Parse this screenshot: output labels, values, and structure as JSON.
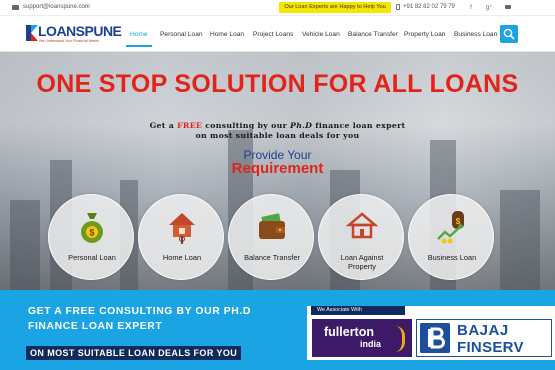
{
  "topbar": {
    "email": "support@loanspune.com",
    "help_text": "Our Loan Experts are Happy to Help You",
    "phone": "+91 82 82 02 79 79",
    "social_icons": [
      "facebook-icon",
      "google-plus-icon",
      "email-icon"
    ]
  },
  "logo": {
    "name_part1": "LOANS",
    "name_part2": "PUNE",
    "tagline": "We Understand Your Financial Needs"
  },
  "nav": {
    "items": [
      {
        "label": "Home",
        "active": true
      },
      {
        "label": "Personal Loan"
      },
      {
        "label": "Home Loan"
      },
      {
        "label": "Project Loans"
      },
      {
        "label": "Vehicle Loan"
      },
      {
        "label": "Balance Transfer"
      },
      {
        "label": "Property Loan"
      },
      {
        "label": "Business Loan"
      }
    ],
    "search_icon": "search-icon"
  },
  "hero": {
    "title": "ONE STOP SOLUTION FOR ALL LOANS",
    "sub_line1_a": "Get a ",
    "sub_line1_free": "FREE",
    "sub_line1_b": " consulting by our ",
    "sub_line1_phd": "Ph.D",
    "sub_line1_c": " finance loan expert",
    "sub_line2": "on most suitable loan deals for you",
    "provide_line1": "Provide Your",
    "provide_line2": "Requirement",
    "cards": [
      {
        "label": "Personal Loan",
        "icon": "money-bag-icon"
      },
      {
        "label": "Home Loan",
        "icon": "house-icon"
      },
      {
        "label": "Balance Transfer",
        "icon": "wallet-icon"
      },
      {
        "label": "Loan Against",
        "label2": "Property",
        "icon": "property-icon"
      },
      {
        "label": "Business Loan",
        "icon": "business-growth-icon"
      }
    ]
  },
  "band": {
    "line1": "GET A FREE CONSULTING BY OUR PH.D",
    "line2": "FINANCE LOAN EXPERT",
    "line3": "ON MOST SUITABLE LOAN DEALS FOR YOU",
    "assoc_header": "We Associate With",
    "partner1_a": "fullerton",
    "partner1_b": "india",
    "partner2_a": "BAJAJ",
    "partner2_b": "FINSERV"
  },
  "colors": {
    "brand_blue": "#1ba4e4",
    "navy": "#0e2b5c",
    "red": "#e2231a",
    "yellow": "#f5e600"
  }
}
